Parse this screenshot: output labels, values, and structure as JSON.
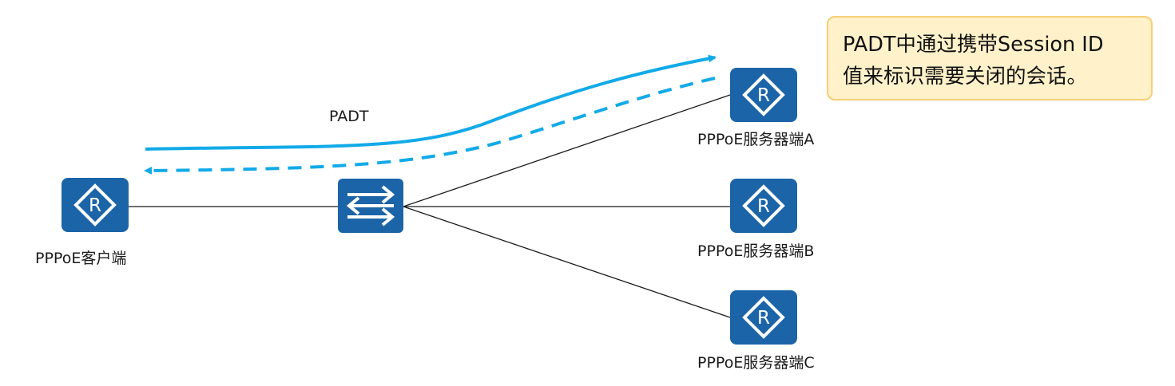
{
  "arrow_label": "PADT",
  "note": {
    "line1": "PADT中通过携带Session ID",
    "line2": "值来标识需要关闭的会话。"
  },
  "devices": {
    "client": {
      "label": "PPPoE客户端",
      "icon": "router-icon"
    },
    "switch": {
      "icon": "switch-icon"
    },
    "server_a": {
      "label": "PPPoE服务器端A",
      "icon": "router-icon"
    },
    "server_b": {
      "label": "PPPoE服务器端B",
      "icon": "router-icon"
    },
    "server_c": {
      "label": "PPPoE服务器端C",
      "icon": "router-icon"
    }
  },
  "colors": {
    "device_fill": "#1c64a8",
    "arrow": "#12aae8",
    "link": "#1a1a1a",
    "note_fill": "#fff1c9",
    "note_border": "#f6cf76"
  }
}
